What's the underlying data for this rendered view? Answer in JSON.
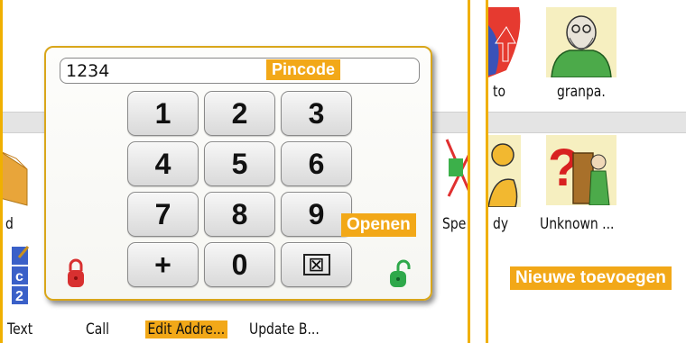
{
  "left_screen": {
    "row1_labels": {
      "left": "d",
      "right": "Spe"
    },
    "row2_labels": {
      "text": "Text",
      "call": "Call",
      "edit_address": "Edit Addre...",
      "update": "Update B..."
    }
  },
  "pin_dialog": {
    "value": "1234",
    "title": "Pincode",
    "keys": [
      "1",
      "2",
      "3",
      "4",
      "5",
      "6",
      "7",
      "8",
      "9",
      "+",
      "0",
      "⊠"
    ],
    "open_label": "Openen"
  },
  "right_screen": {
    "row1": {
      "left": "to",
      "right": "granpa."
    },
    "row2": {
      "left": "dy",
      "right": "Unknown ..."
    },
    "add_new_label": "Nieuwe toevoegen"
  },
  "colors": {
    "accent": "#f2a818",
    "lock_closed": "#d83030",
    "lock_open": "#2ea84a"
  },
  "icons": {
    "pictogram_grandpa": "grandpa-pictogram",
    "pictogram_unknown": "question-door-pictogram"
  }
}
